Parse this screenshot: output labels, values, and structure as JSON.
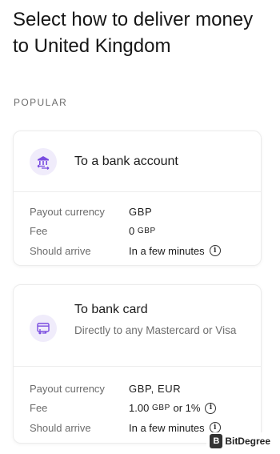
{
  "header": {
    "title": "Select how to deliver money to United Kingdom"
  },
  "section": {
    "label": "POPULAR"
  },
  "options": [
    {
      "title": "To a bank account",
      "icon": "bank-transfer-icon",
      "rows": [
        {
          "label": "Payout currency",
          "value": "GBP"
        },
        {
          "label": "Fee",
          "value_main": "0",
          "value_unit": "GBP"
        },
        {
          "label": "Should arrive",
          "value": "In a few minutes"
        }
      ]
    },
    {
      "title": "To bank card",
      "subtitle": "Directly to any Mastercard or Visa",
      "icon": "card-transfer-icon",
      "rows": [
        {
          "label": "Payout currency",
          "value": "GBP, EUR"
        },
        {
          "label": "Fee",
          "value_main": "1.00",
          "value_unit": "GBP",
          "value_suffix": "or 1%"
        },
        {
          "label": "Should arrive",
          "value": "In a few minutes"
        }
      ]
    }
  ],
  "watermark": {
    "logo": "B",
    "text": "BitDegree"
  },
  "colors": {
    "accent": "#7a4de0",
    "icon_bg": "#f0ecfb",
    "text_muted": "#6c6c6c"
  }
}
